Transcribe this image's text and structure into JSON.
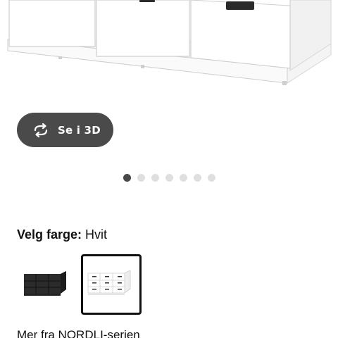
{
  "product": {
    "image_alt": "NORDLI kommode, hvit",
    "image_icon": "dresser-image"
  },
  "view_3d": {
    "label": "Se i 3D",
    "icon": "rotate-3d-icon"
  },
  "carousel": {
    "total": 7,
    "active_index": 0
  },
  "color_picker": {
    "heading_label": "Velg farge:",
    "selected_value": "Hvit",
    "options": [
      {
        "name": "Antrasitt",
        "color": "#2b2b2b",
        "selected": false
      },
      {
        "name": "Hvit",
        "color": "#ffffff",
        "selected": true
      }
    ]
  },
  "series_link": {
    "label": "Mer fra NORDLI-serien"
  },
  "colors": {
    "button_bg": "#4a4a4a",
    "dot_active": "#484848",
    "dot_inactive": "#dfdfdf",
    "selected_border": "#111111"
  }
}
